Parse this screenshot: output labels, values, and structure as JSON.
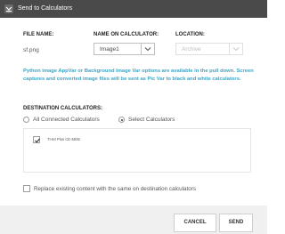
{
  "window": {
    "title": "Send to Calculators",
    "app_icon": "ti-connect-icon"
  },
  "columns": {
    "file_name": "FILE NAME:",
    "name_on_calculator": "NAME ON CALCULATOR:",
    "location": "LOCATION:"
  },
  "file_row": {
    "file_name": "sf.png",
    "calc_name_value": "Image1",
    "location_value": "Archive",
    "location_enabled": false
  },
  "info_text": "Python image AppVar or Background Image Var options are available in the pull down. Screen captures and converted image files will be sent as Pic Var to black and white calculators.",
  "destination": {
    "label": "DESTINATION CALCULATORS:",
    "options": [
      {
        "label": "All Connected Calculators",
        "selected": false
      },
      {
        "label": "Select Calculators",
        "selected": true
      }
    ],
    "calculators": [
      {
        "name": "TI-84 Plus CE-5935",
        "checked": true
      }
    ]
  },
  "replace_option": {
    "label": "Replace existing content with the same on destination calculators",
    "checked": false
  },
  "buttons": {
    "cancel": "CANCEL",
    "send": "SEND"
  },
  "colors": {
    "titlebar": "#4a4a4a",
    "info_text": "#3ba5c6",
    "footer": "#f0f0f0"
  }
}
